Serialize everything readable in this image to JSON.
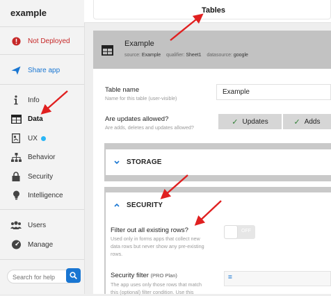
{
  "sidebar": {
    "app_name": "example",
    "status_label": "Not Deployed",
    "share_label": "Share app",
    "nav": [
      {
        "label": "Info"
      },
      {
        "label": "Data"
      },
      {
        "label": "UX"
      },
      {
        "label": "Behavior"
      },
      {
        "label": "Security"
      },
      {
        "label": "Intelligence"
      }
    ],
    "users_label": "Users",
    "manage_label": "Manage",
    "search_placeholder": "Search for help"
  },
  "header": {
    "title": "Tables"
  },
  "table_card": {
    "title": "Example",
    "source_key": "source:",
    "source_value": "Example",
    "qualifier_key": "qualifier:",
    "qualifier_value": "Sheet1",
    "datasource_key": "datasource:",
    "datasource_value": "google"
  },
  "form": {
    "table_name_label": "Table name",
    "table_name_sub": "Name for this table (user-visible)",
    "table_name_value": "Example",
    "updates_label": "Are updates allowed?",
    "updates_sub": "Are adds, deletes and updates allowed?",
    "updates_btn": "Updates",
    "adds_btn": "Adds"
  },
  "sections": {
    "storage": "STORAGE",
    "security": "SECURITY"
  },
  "security": {
    "filter_rows_label": "Filter out all existing rows?",
    "filter_rows_sub": [
      "Used only in forms apps that collect new",
      "data rows but never show any pre-existing",
      "rows."
    ],
    "switch_state": "OFF",
    "security_filter_label": "Security filter",
    "security_filter_plan": "(PRO Plan)",
    "security_filter_sub": [
      "The app uses only those rows that match",
      "this (optional) filter condition. Use this"
    ],
    "filter_symbol": "="
  },
  "colors": {
    "accent": "#1976d2",
    "warning": "#c62828",
    "annotation": "#e02020"
  }
}
